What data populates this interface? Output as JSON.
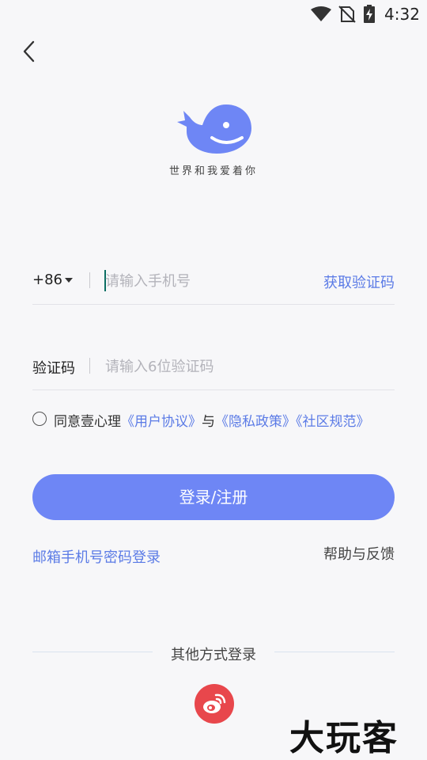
{
  "status_bar": {
    "time": "4:32",
    "icons": [
      "wifi-icon",
      "no-sim-icon",
      "battery-charging-icon"
    ]
  },
  "header": {
    "back_icon": "chevron-left-icon"
  },
  "brand": {
    "logo_icon": "whale-logo-icon",
    "slogan": "世界和我爱着你",
    "color": "#6e86f5"
  },
  "phone": {
    "country_code": "+86",
    "placeholder": "请输入手机号",
    "value": "",
    "get_code_label": "获取验证码"
  },
  "code": {
    "label": "验证码",
    "placeholder": "请输入6位验证码",
    "value": ""
  },
  "agreement": {
    "checked": false,
    "prefix": "同意壹心理",
    "user_agreement": "《用户协议》",
    "and": "与",
    "privacy_policy": "《隐私政策》",
    "community_rules": "《社区规范》"
  },
  "actions": {
    "login_label": "登录/注册",
    "email_login_label": "邮箱手机号密码登录",
    "help_label": "帮助与反馈"
  },
  "other_login": {
    "label": "其他方式登录",
    "weibo_icon": "weibo-icon",
    "weibo_color": "#e8474c"
  },
  "watermark": {
    "text": "大玩客"
  },
  "colors": {
    "accent": "#6e86f5",
    "link": "#5b7be6",
    "background": "#f7f7f9"
  }
}
